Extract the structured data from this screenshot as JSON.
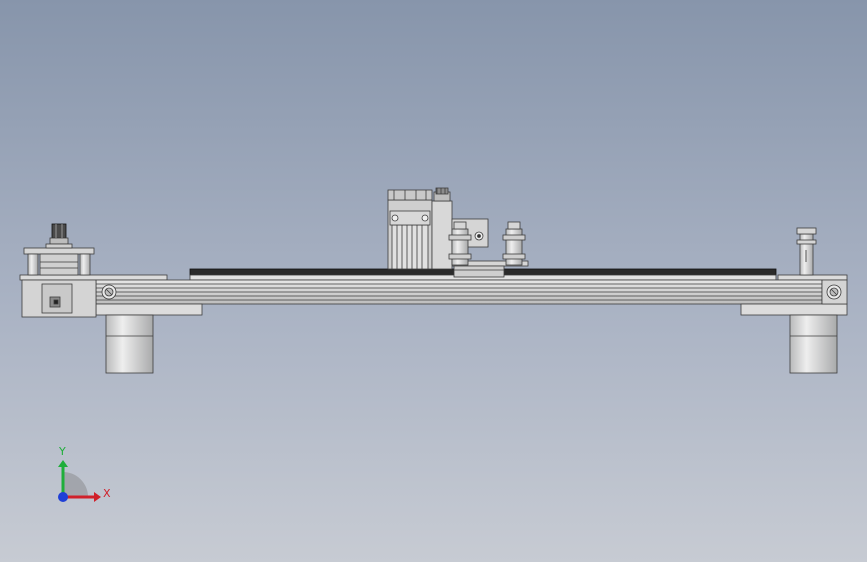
{
  "viewport": {
    "background_top": "#8795ab",
    "background_bottom": "#c7cbd3",
    "part_fill": "#d9dadb",
    "part_stroke": "#3c3c3c",
    "belt_color": "#2b2b2b"
  },
  "triad": {
    "x_label": "X",
    "y_label": "Y",
    "x_color": "#d0202a",
    "y_color": "#1fae3a",
    "z_color": "#1f3fd6"
  }
}
